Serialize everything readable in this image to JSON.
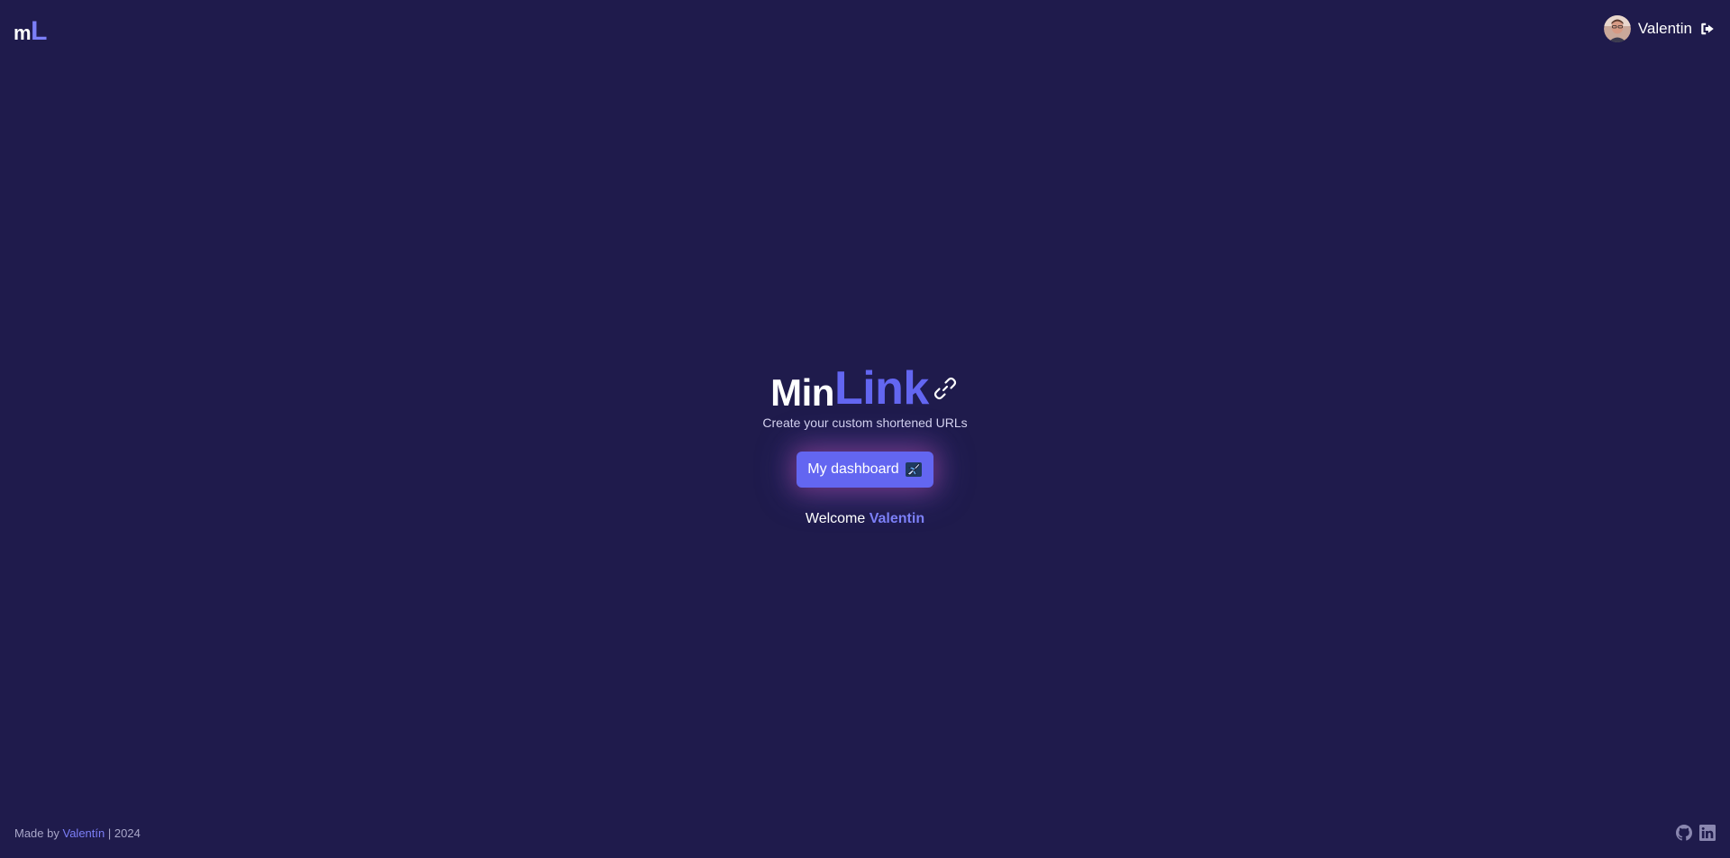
{
  "header": {
    "logo": {
      "part1": "m",
      "part2": "L"
    },
    "user": {
      "name": "Valentin",
      "avatar_icon": "avatar-photo",
      "logout_icon": "logout-icon"
    }
  },
  "hero": {
    "brand_min": "Min",
    "brand_link": "Link",
    "brand_icon": "chain-link-icon",
    "tagline": "Create your custom shortened URLs",
    "dashboard_button": {
      "label": "My dashboard",
      "icon": "airplane-emoji"
    },
    "welcome": {
      "prefix": "Welcome",
      "name": "Valentin"
    }
  },
  "footer": {
    "made_by": "Made by",
    "author": "Valentín",
    "separator": "|",
    "year": "2024",
    "social": [
      {
        "name": "GitHub",
        "icon": "github-icon"
      },
      {
        "name": "LinkedIn",
        "icon": "linkedin-icon"
      }
    ]
  },
  "colors": {
    "background": "#1f1b4c",
    "accent": "#6366f1",
    "accent_light": "#7c7ff7",
    "text": "#ffffff",
    "muted": "#a9a7c9"
  }
}
